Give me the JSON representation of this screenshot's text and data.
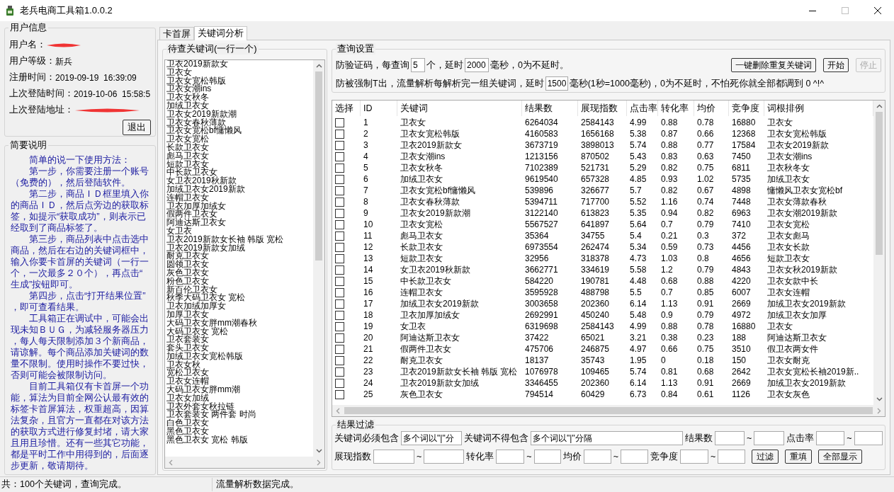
{
  "window": {
    "title": "老兵电商工具箱1.0.0.2"
  },
  "user_info": {
    "title": "用户信息",
    "fields": [
      {
        "label": "用户名：",
        "redacted": true
      },
      {
        "label": "用户等级：",
        "value": "新兵",
        "redacted": false
      },
      {
        "label": "注册时间：",
        "value": "2019-09-19  16:39:09",
        "redacted": false
      },
      {
        "label": "上次登陆时间：",
        "value": "2019-10-06  15:58:5",
        "redacted": false
      },
      {
        "label": "上次登陆地址：",
        "redacted": true
      }
    ],
    "logout_button": "退出"
  },
  "guide": {
    "title": "简要说明",
    "paragraphs": [
      "简单的说一下使用方法：",
      "第一步，你需要注册一个账号（免费的），然后登陆软件。",
      "第二步，商品ＩＤ框里填入你的商品ＩＤ，然后点旁边的获取标签，如提示“获取成功”，则表示已经取到了商品标签了。",
      "第三步，商品列表中点击选中商品，然后在右边的关键词框中，输入你要卡首屏的关键词（一行一个，一次最多２０个），再点击“生成”按钮即可。",
      "第四步，点击“打开结果位置”，即可查看结果。",
      "工具箱正在调试中，可能会出现未知ＢＵＧ，为减轻服务器压力，每人每天限制添加３个新商品，请谅解。每个商品添加关键词的数量不限制。使用时操作不要过快，否则可能会被限制访问。",
      "目前工具箱仅有卡首屏一个功能，算法为目前全网公认最有效的标签卡首屏算法，权重超高，因算法复杂，且官方一直都在对该方法的获取方式进行修复封堵，请大家且用且珍惜。还有一些其它功能，都是平时工作中用得到的，后面逐步更新，敬请期待。"
    ]
  },
  "tabs": [
    {
      "label": "卡首屏",
      "selected": false
    },
    {
      "label": "关键词分析",
      "selected": true
    }
  ],
  "keyword_input": {
    "title": "待查关键词(一行一个)",
    "lines": [
      "卫衣2019新款女",
      "卫衣女",
      "卫衣女宽松韩版",
      "卫衣女潮ins",
      "卫衣女秋冬",
      "加绒卫衣女",
      "卫衣女2019新款潮",
      "卫衣女春秋薄款",
      "卫衣女宽松bf慵懒风",
      "卫衣女宽松",
      "长款卫衣女",
      "彪马卫衣女",
      "短款卫衣女",
      "中长款卫衣女",
      "女卫衣2019秋新款",
      "加绒卫衣女2019新款",
      "连帽卫衣女",
      "卫衣加厚加绒女",
      "假两件卫衣女",
      "阿迪达斯卫衣女",
      "女卫衣",
      "卫衣2019新款女长袖 韩版 宽松",
      "卫衣2019新款女加绒",
      "耐克卫衣女",
      "圆领卫衣女",
      "灰色卫衣女",
      "粉色卫衣女",
      "新百伦卫衣女",
      "秋季大码卫衣女 宽松",
      "卫衣加绒加厚女",
      "加厚卫衣女",
      "大码卫衣女胖mm潮春秋",
      "大码卫衣女 宽松",
      "卫衣套装女",
      "套头卫衣女",
      "加绒卫衣女宽松韩版",
      "卫衣女秋",
      "宽松卫衣女",
      "卫衣女连帽",
      "大码卫衣女胖mm潮",
      "卫衣女加绒",
      "卫衣外套女秋拉链",
      "卫衣套装女 两件套 时尚",
      "白色卫衣女",
      "黑色卫衣女",
      "黑色卫衣女 宽松 韩版"
    ]
  },
  "query_settings": {
    "title": "查询设置",
    "line_1": [
      {
        "kind": "text",
        "text": "防验证码，每查询"
      },
      {
        "kind": "field",
        "value": "5"
      },
      {
        "kind": "text",
        "text": "个，延时"
      },
      {
        "kind": "field",
        "value": "2000"
      },
      {
        "kind": "text",
        "text": "毫秒，0为不延时。"
      }
    ],
    "buttons": [
      {
        "label": "一键删除重复关键词",
        "disabled": false
      },
      {
        "label": "开始",
        "disabled": false
      },
      {
        "label": "停止",
        "disabled": true
      }
    ],
    "line_2": [
      {
        "kind": "text",
        "text": "防被强制T出，流量解析每解析完一组关键词，延时"
      },
      {
        "kind": "field",
        "value": "1500"
      },
      {
        "kind": "text",
        "text": "毫秒(1秒=1000毫秒)，0为不延时，不怕死你就全部都调到 0 ^!^"
      }
    ]
  },
  "table": {
    "select_column": "选择",
    "columns": [
      "ID",
      "关键词",
      "结果数",
      "展现指数",
      "点击率",
      "转化率",
      "均价",
      "竞争度",
      "词根排例"
    ],
    "rows": [
      {
        "checked": false,
        "cells": [
          "1",
          "卫衣女",
          "6264034",
          "2584143",
          "4.99",
          "0.88",
          "0.78",
          "16880",
          "卫衣女"
        ]
      },
      {
        "checked": false,
        "cells": [
          "2",
          "卫衣女宽松韩版",
          "4160583",
          "1656168",
          "5.38",
          "0.87",
          "0.66",
          "12368",
          "卫衣女宽松韩版"
        ]
      },
      {
        "checked": false,
        "cells": [
          "3",
          "卫衣2019新款女",
          "3673719",
          "3898013",
          "5.74",
          "0.88",
          "0.77",
          "17584",
          "卫衣女2019新款"
        ]
      },
      {
        "checked": false,
        "cells": [
          "4",
          "卫衣女潮ins",
          "1213156",
          "870502",
          "5.43",
          "0.83",
          "0.63",
          "7450",
          "卫衣女潮ins"
        ]
      },
      {
        "checked": false,
        "cells": [
          "5",
          "卫衣女秋冬",
          "7102389",
          "521731",
          "5.29",
          "0.82",
          "0.75",
          "6811",
          "卫衣秋冬女"
        ]
      },
      {
        "checked": false,
        "cells": [
          "6",
          "加绒卫衣女",
          "9619540",
          "657328",
          "4.85",
          "0.93",
          "1.02",
          "5735",
          "加绒卫衣女"
        ]
      },
      {
        "checked": false,
        "cells": [
          "7",
          "卫衣女宽松bf慵懒风",
          "539896",
          "326677",
          "5.7",
          "0.82",
          "0.67",
          "4898",
          "慵懒风卫衣女宽松bf"
        ]
      },
      {
        "checked": false,
        "cells": [
          "8",
          "卫衣女春秋薄款",
          "5394711",
          "717700",
          "5.52",
          "1.16",
          "0.74",
          "7448",
          "卫衣女薄款春秋"
        ]
      },
      {
        "checked": false,
        "cells": [
          "9",
          "卫衣女2019新款潮",
          "3122140",
          "613823",
          "5.35",
          "0.94",
          "0.82",
          "6963",
          "卫衣女潮2019新款"
        ]
      },
      {
        "checked": false,
        "cells": [
          "10",
          "卫衣女宽松",
          "5567527",
          "641897",
          "5.64",
          "0.7",
          "0.79",
          "7410",
          "卫衣女宽松"
        ]
      },
      {
        "checked": false,
        "cells": [
          "11",
          "彪马卫衣女",
          "35364",
          "34755",
          "5.4",
          "0.21",
          "0.3",
          "372",
          "卫衣女彪马"
        ]
      },
      {
        "checked": false,
        "cells": [
          "12",
          "长款卫衣女",
          "6973554",
          "262474",
          "5.34",
          "0.59",
          "0.73",
          "4456",
          "卫衣女长款"
        ]
      },
      {
        "checked": false,
        "cells": [
          "13",
          "短款卫衣女",
          "32956",
          "318378",
          "4.73",
          "1.03",
          "0.8",
          "4656",
          "短款卫衣女"
        ]
      },
      {
        "checked": false,
        "cells": [
          "14",
          "女卫衣2019秋新款",
          "3662771",
          "334619",
          "5.58",
          "1.2",
          "0.79",
          "4843",
          "卫衣女秋2019新款"
        ]
      },
      {
        "checked": false,
        "cells": [
          "15",
          "中长款卫衣女",
          "584220",
          "190781",
          "4.48",
          "0.68",
          "0.88",
          "4220",
          "卫衣女款中长"
        ]
      },
      {
        "checked": false,
        "cells": [
          "16",
          "连帽卫衣女",
          "3595928",
          "488798",
          "5.5",
          "0.7",
          "0.85",
          "6007",
          "卫衣女连帽"
        ]
      },
      {
        "checked": false,
        "cells": [
          "17",
          "加绒卫衣女2019新款",
          "3003658",
          "202360",
          "6.14",
          "1.13",
          "0.91",
          "2669",
          "加绒卫衣女2019新款"
        ]
      },
      {
        "checked": false,
        "cells": [
          "18",
          "卫衣加厚加绒女",
          "2692991",
          "450240",
          "5.48",
          "0.9",
          "0.79",
          "4972",
          "加绒卫衣女加厚"
        ]
      },
      {
        "checked": false,
        "cells": [
          "19",
          "女卫衣",
          "6319698",
          "2584143",
          "4.99",
          "0.88",
          "0.78",
          "16880",
          "卫衣女"
        ]
      },
      {
        "checked": false,
        "cells": [
          "20",
          "阿迪达斯卫衣女",
          "37422",
          "65021",
          "3.21",
          "0.38",
          "0.23",
          "188",
          "阿迪达斯卫衣女"
        ]
      },
      {
        "checked": false,
        "cells": [
          "21",
          "假两件卫衣女",
          "475706",
          "246875",
          "4.97",
          "0.66",
          "0.75",
          "3510",
          "假卫衣两女件"
        ]
      },
      {
        "checked": false,
        "cells": [
          "22",
          "耐克卫衣女",
          "18137",
          "35743",
          "1.95",
          "0",
          "0.18",
          "150",
          "卫衣女耐克"
        ]
      },
      {
        "checked": false,
        "cells": [
          "23",
          "卫衣2019新款女长袖 韩版 宽松",
          "1076978",
          "109465",
          "5.74",
          "0.81",
          "0.68",
          "2642",
          "卫衣女宽松长袖2019新.."
        ]
      },
      {
        "checked": false,
        "cells": [
          "24",
          "卫衣2019新款女加绒",
          "3346455",
          "202360",
          "6.14",
          "1.13",
          "0.91",
          "2669",
          "加绒卫衣女2019新款"
        ]
      },
      {
        "checked": false,
        "cells": [
          "25",
          "灰色卫衣女",
          "794514",
          "60429",
          "6.73",
          "0.84",
          "0.61",
          "1126",
          "卫衣女灰色"
        ]
      }
    ]
  },
  "filter": {
    "title": "结果过滤",
    "row_1": [
      {
        "kind": "label",
        "text": "关键词必须包含"
      },
      {
        "kind": "field",
        "value": "多个词以\"|\"分"
      },
      {
        "kind": "label",
        "text": "关键词不得包含"
      },
      {
        "kind": "field",
        "value": "多个词以\"|\"分隔"
      },
      {
        "kind": "label",
        "text": "结果数"
      },
      {
        "kind": "field"
      },
      {
        "kind": "label",
        "text": "~"
      },
      {
        "kind": "field"
      },
      {
        "kind": "label",
        "text": "点击率"
      },
      {
        "kind": "field"
      },
      {
        "kind": "label",
        "text": "~"
      },
      {
        "kind": "field"
      }
    ],
    "row_2": [
      {
        "kind": "label",
        "text": "展现指数"
      },
      {
        "kind": "field"
      },
      {
        "kind": "label",
        "text": "~"
      },
      {
        "kind": "field"
      },
      {
        "kind": "label",
        "text": "转化率"
      },
      {
        "kind": "field"
      },
      {
        "kind": "label",
        "text": "~"
      },
      {
        "kind": "field"
      },
      {
        "kind": "label",
        "text": "均价"
      },
      {
        "kind": "field"
      },
      {
        "kind": "label",
        "text": "~"
      },
      {
        "kind": "field"
      },
      {
        "kind": "label",
        "text": "竞争度"
      },
      {
        "kind": "field"
      },
      {
        "kind": "label",
        "text": "~"
      },
      {
        "kind": "field"
      },
      {
        "kind": "button",
        "text": "过滤"
      },
      {
        "kind": "button",
        "text": "重填"
      },
      {
        "kind": "button",
        "text": "全部显示"
      }
    ]
  },
  "status_bar": [
    "共：100个关键词，查询完成。",
    "流量解析数据完成。"
  ]
}
